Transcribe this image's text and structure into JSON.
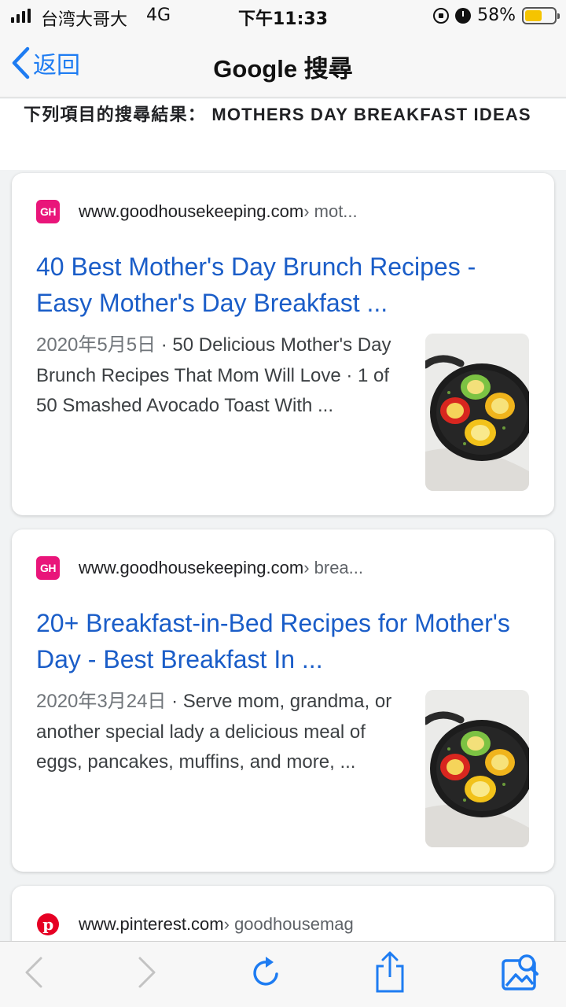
{
  "status_bar": {
    "carrier": "台湾大哥大",
    "network": "4G",
    "time": "下午11:33",
    "battery_percent": "58%",
    "battery_level": 0.58,
    "battery_color": "#f5c400"
  },
  "nav": {
    "back_label": "返回",
    "title": "Google 搜尋"
  },
  "query": {
    "prefix": "下列項目的搜尋結果：",
    "term": "mothers day breakfast ideas"
  },
  "results": [
    {
      "favicon": "GH",
      "domain": "www.goodhousekeeping.com",
      "path": " › mot...",
      "title": "40 Best Mother's Day Brunch Recipes - Easy Mother's Day Breakfast ...",
      "date": "2020年5月5日",
      "snippet": " · 50 Delicious Mother's Day Brunch Recipes That Mom Will Love · 1 of 50 Smashed Avocado Toast With ..."
    },
    {
      "favicon": "GH",
      "domain": "www.goodhousekeeping.com",
      "path": " › brea...",
      "title": "20+ Breakfast-in-Bed Recipes for Mother's Day - Best Breakfast In ...",
      "date": "2020年3月24日",
      "snippet": " · Serve mom, grandma, or another special lady a delicious meal of eggs, pancakes, muffins, and more, ..."
    },
    {
      "favicon": "pinterest-icon",
      "domain": "www.pinterest.com",
      "path": " › goodhousemag"
    }
  ],
  "colors": {
    "link": "#1a5dc8",
    "ios_blue": "#1e7cf2",
    "gh_brand": "#e9157a",
    "pinterest_red": "#e60023"
  },
  "icons": {
    "back": "chevron-left-icon",
    "toolbar": [
      "back-arrow-icon",
      "forward-arrow-icon",
      "reload-icon",
      "share-icon",
      "image-search-icon"
    ]
  }
}
